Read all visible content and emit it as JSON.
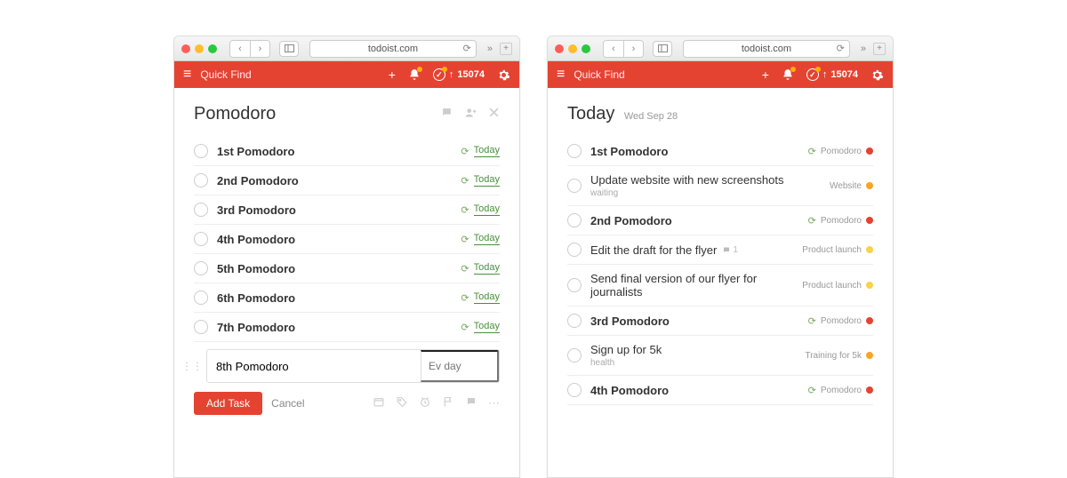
{
  "left": {
    "url": "todoist.com",
    "quick_find": "Quick Find",
    "karma": "15074",
    "view_title": "Pomodoro",
    "tasks": [
      {
        "title": "1st Pomodoro",
        "badge": "Today"
      },
      {
        "title": "2nd Pomodoro",
        "badge": "Today"
      },
      {
        "title": "3rd Pomodoro",
        "badge": "Today"
      },
      {
        "title": "4th Pomodoro",
        "badge": "Today"
      },
      {
        "title": "5th Pomodoro",
        "badge": "Today"
      },
      {
        "title": "6th Pomodoro",
        "badge": "Today"
      },
      {
        "title": "7th Pomodoro",
        "badge": "Today"
      }
    ],
    "new_task": {
      "value": "8th Pomodoro",
      "schedule_placeholder": "Ev day",
      "add_label": "Add Task",
      "cancel_label": "Cancel"
    }
  },
  "right": {
    "url": "todoist.com",
    "quick_find": "Quick Find",
    "karma": "15074",
    "view_title": "Today",
    "view_date": "Wed Sep 28",
    "tasks": [
      {
        "title": "1st Pomodoro",
        "project": "Pomodoro",
        "dot": "red",
        "recur": true,
        "bold": true
      },
      {
        "title": "Update website with new screenshots",
        "sub": "waiting",
        "project": "Website",
        "dot": "orange",
        "bold": false
      },
      {
        "title": "2nd Pomodoro",
        "project": "Pomodoro",
        "dot": "red",
        "recur": true,
        "bold": true
      },
      {
        "title": "Edit the draft for the flyer",
        "comment": "1",
        "project": "Product launch",
        "dot": "yellow",
        "bold": false
      },
      {
        "title": "Send final version of our flyer for journalists",
        "project": "Product launch",
        "dot": "yellow",
        "bold": false
      },
      {
        "title": "3rd Pomodoro",
        "project": "Pomodoro",
        "dot": "red",
        "recur": true,
        "bold": true
      },
      {
        "title": "Sign up for 5k",
        "sub": "health",
        "project": "Training for 5k",
        "dot": "orange",
        "bold": false
      },
      {
        "title": "4th Pomodoro",
        "project": "Pomodoro",
        "dot": "red",
        "recur": true,
        "bold": true
      }
    ]
  }
}
